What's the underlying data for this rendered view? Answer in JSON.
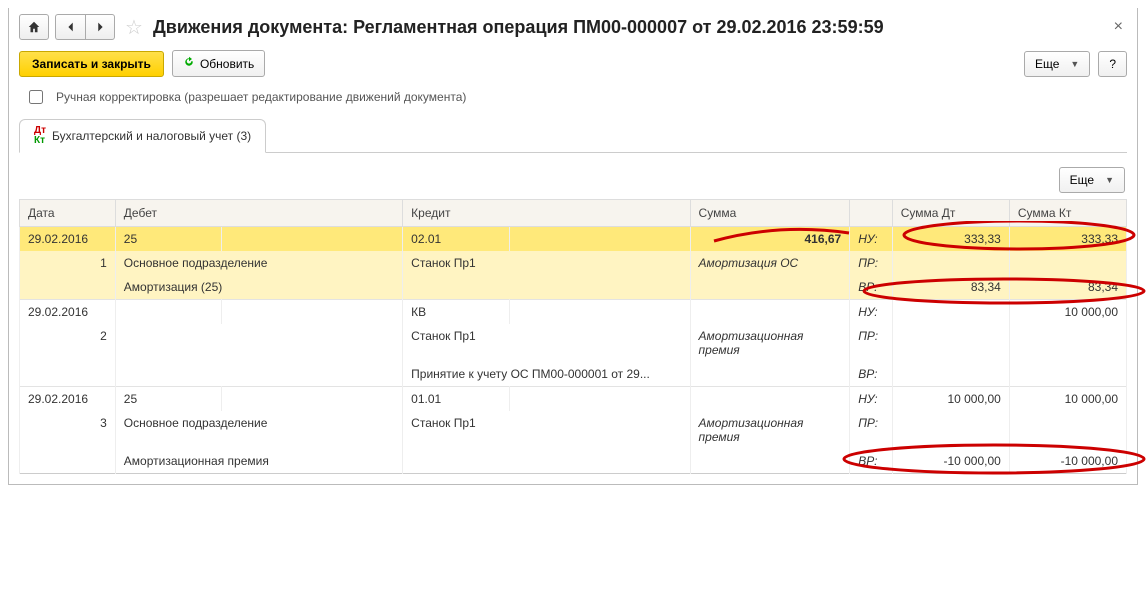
{
  "title": "Движения документа: Регламентная операция ПМ00-000007 от 29.02.2016 23:59:59",
  "toolbar": {
    "save_close": "Записать и закрыть",
    "refresh": "Обновить",
    "more": "Еще",
    "help": "?"
  },
  "checkbox_label": "Ручная корректировка (разрешает редактирование движений документа)",
  "tab_label": "Бухгалтерский и налоговый учет (3)",
  "sub_more": "Еще",
  "headers": {
    "date": "Дата",
    "debit": "Дебет",
    "credit": "Кредит",
    "sum": "Сумма",
    "sum_dt": "Сумма Дт",
    "sum_kt": "Сумма Кт"
  },
  "labels": {
    "nu": "НУ:",
    "pr": "ПР:",
    "vr": "ВР:"
  },
  "rows": [
    {
      "highlight": true,
      "date": "29.02.2016",
      "num": "1",
      "debit_acc": "25",
      "debit_sub1": "Основное подразделение",
      "debit_sub2": "Амортизация (25)",
      "credit_acc": "02.01",
      "credit_sub1": "Станок Пр1",
      "credit_sub2": "",
      "sum": "416,67",
      "sum_desc": "Амортизация ОС",
      "nu_dt": "333,33",
      "nu_kt": "333,33",
      "pr_dt": "",
      "pr_kt": "",
      "vr_dt": "83,34",
      "vr_kt": "83,34"
    },
    {
      "highlight": false,
      "date": "29.02.2016",
      "num": "2",
      "debit_acc": "",
      "debit_sub1": "",
      "debit_sub2": "",
      "credit_acc": "КВ",
      "credit_sub1": "Станок Пр1",
      "credit_sub2": "Принятие к учету ОС ПМ00-000001 от 29...",
      "sum": "",
      "sum_desc": "Амортизационная премия",
      "nu_dt": "",
      "nu_kt": "10 000,00",
      "pr_dt": "",
      "pr_kt": "",
      "vr_dt": "",
      "vr_kt": ""
    },
    {
      "highlight": false,
      "date": "29.02.2016",
      "num": "3",
      "debit_acc": "25",
      "debit_sub1": "Основное подразделение",
      "debit_sub2": "Амортизационная премия",
      "credit_acc": "01.01",
      "credit_sub1": "Станок Пр1",
      "credit_sub2": "",
      "sum": "",
      "sum_desc": "Амортизационная премия",
      "nu_dt": "10 000,00",
      "nu_kt": "10 000,00",
      "pr_dt": "",
      "pr_kt": "",
      "vr_dt": "-10 000,00",
      "vr_kt": "-10 000,00",
      "vr_neg": true
    }
  ]
}
